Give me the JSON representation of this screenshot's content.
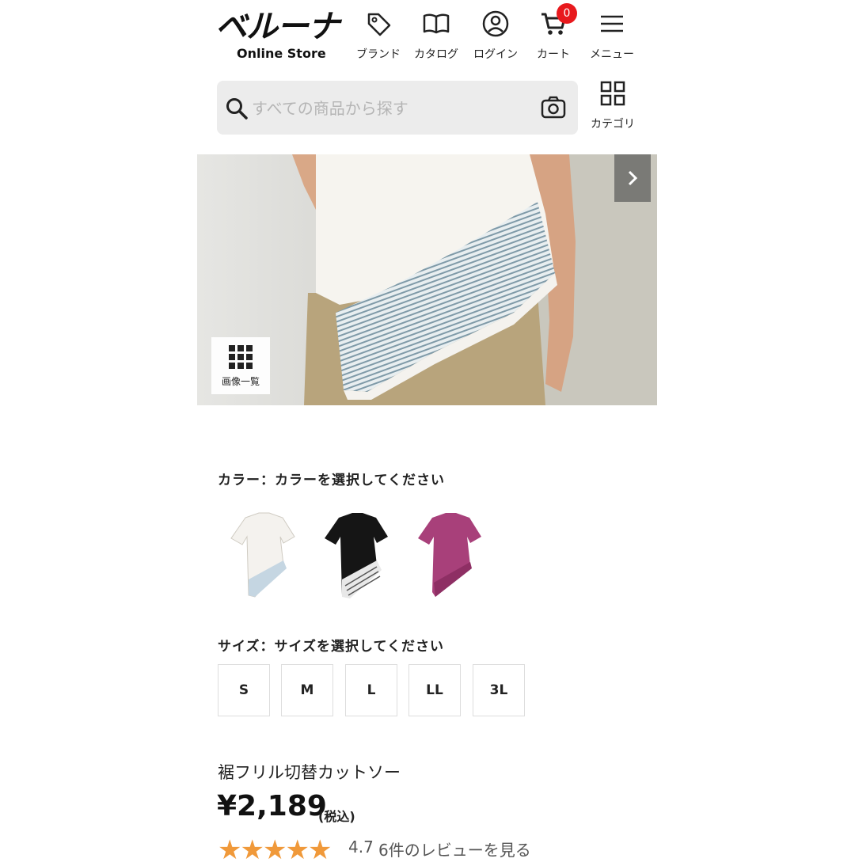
{
  "header": {
    "logo_main": "ベルーナ",
    "logo_sub": "Online Store",
    "nav": [
      {
        "label": "ブランド",
        "icon": "tag-icon"
      },
      {
        "label": "カタログ",
        "icon": "book-icon"
      },
      {
        "label": "ログイン",
        "icon": "user-icon"
      },
      {
        "label": "カート",
        "icon": "cart-icon",
        "badge": "0"
      },
      {
        "label": "メニュー",
        "icon": "menu-icon"
      }
    ]
  },
  "search": {
    "placeholder": "すべての商品から探す",
    "category_label": "カテゴリ"
  },
  "hero": {
    "gallery_label": "画像一覧"
  },
  "product": {
    "color_label": "カラー：カラーを選択してください",
    "colors": [
      "white",
      "black",
      "purple"
    ],
    "color_hex": [
      "#f4f2ee",
      "#151515",
      "#a8407a"
    ],
    "size_label": "サイズ：サイズを選択してください",
    "sizes": [
      "S",
      "M",
      "L",
      "LL",
      "3L"
    ],
    "name": "裾フリル切替カットソー",
    "price": "¥2,189",
    "tax_note": "(税込)",
    "rating": "4.7",
    "rating_value": 4.7,
    "reviews_link": "6件のレビューを見る"
  },
  "colors": {
    "badge": "#e8191d",
    "star": "#f0993a"
  }
}
